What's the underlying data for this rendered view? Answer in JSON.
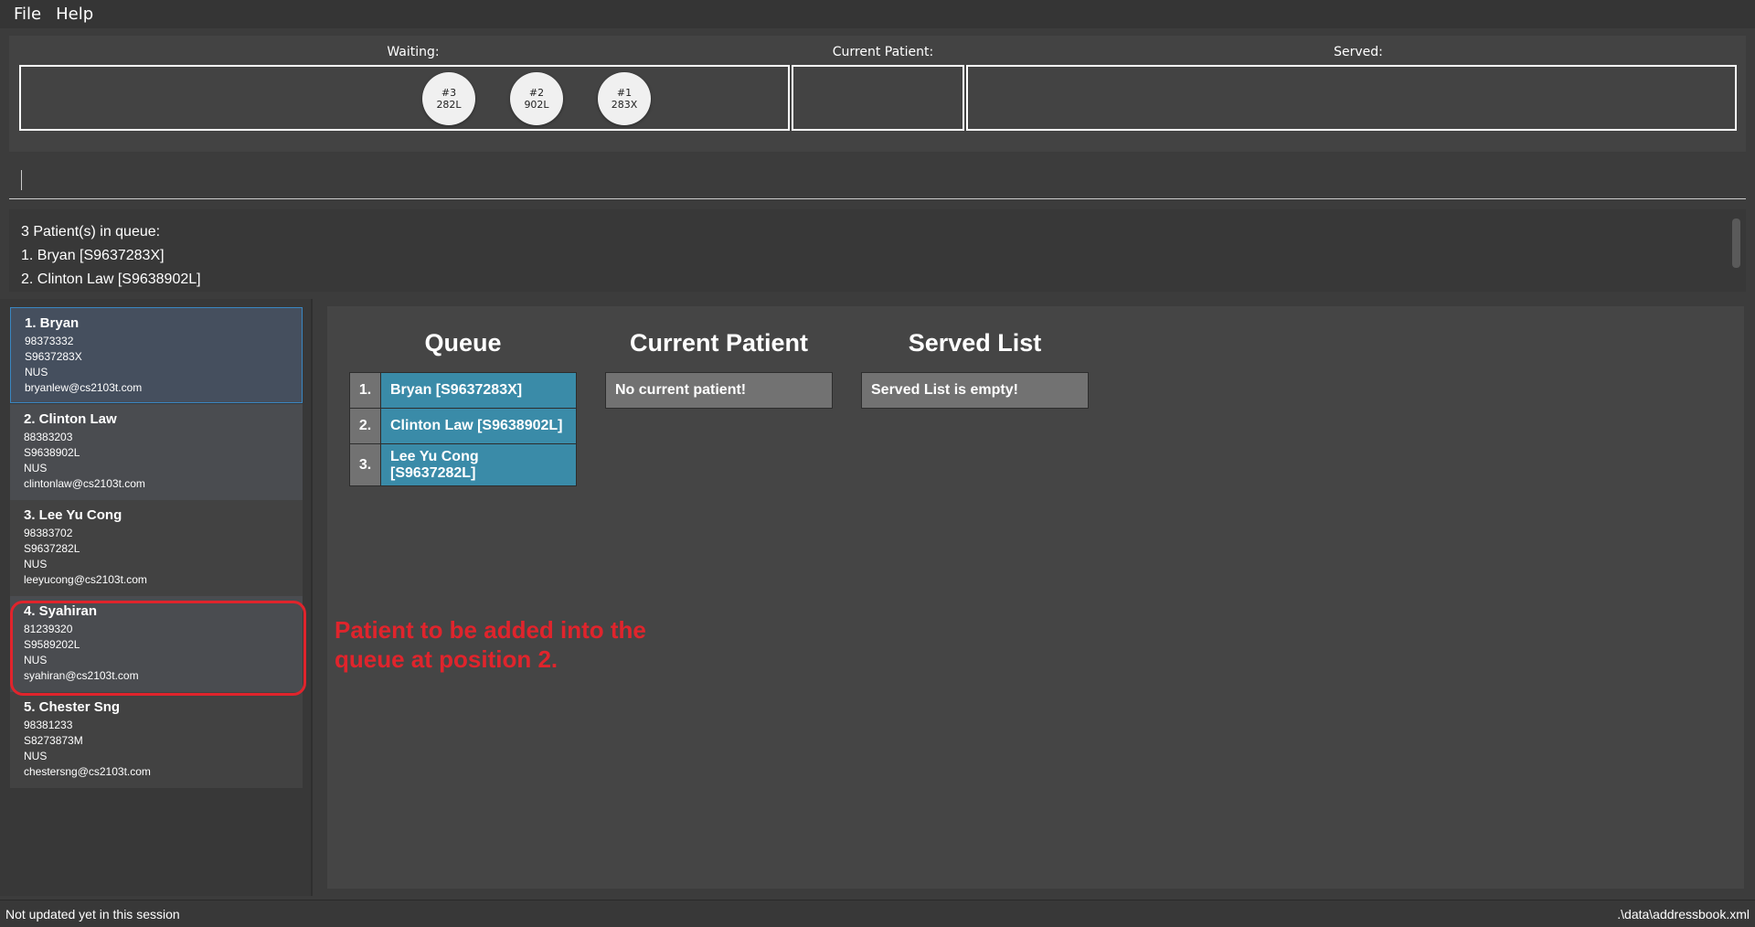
{
  "menu": {
    "file": "File",
    "help": "Help"
  },
  "queue_panel": {
    "waiting_label": "Waiting:",
    "current_label": "Current Patient:",
    "served_label": "Served:",
    "tokens": [
      {
        "num": "#3",
        "code": "282L"
      },
      {
        "num": "#2",
        "code": "902L"
      },
      {
        "num": "#1",
        "code": "283X"
      }
    ]
  },
  "command": {
    "value": ""
  },
  "result": {
    "lines": [
      "3 Patient(s) in queue:",
      "1. Bryan [S9637283X]",
      "2. Clinton Law [S9638902L]"
    ]
  },
  "patients": [
    {
      "name": "1.  Bryan",
      "phone": "98373332",
      "nric": "S9637283X",
      "school": "NUS",
      "email": "bryanlew@cs2103t.com"
    },
    {
      "name": "2.  Clinton Law",
      "phone": "88383203",
      "nric": "S9638902L",
      "school": "NUS",
      "email": "clintonlaw@cs2103t.com"
    },
    {
      "name": "3.  Lee Yu Cong",
      "phone": "98383702",
      "nric": "S9637282L",
      "school": "NUS",
      "email": "leeyucong@cs2103t.com"
    },
    {
      "name": "4.  Syahiran",
      "phone": "81239320",
      "nric": "S9589202L",
      "school": "NUS",
      "email": "syahiran@cs2103t.com"
    },
    {
      "name": "5.  Chester Sng",
      "phone": "98381233",
      "nric": "S8273873M",
      "school": "NUS",
      "email": "chestersng@cs2103t.com"
    }
  ],
  "browser": {
    "queue_title": "Queue",
    "current_title": "Current Patient",
    "served_title": "Served List",
    "queue": [
      {
        "num": "1.",
        "name": "Bryan [S9637283X]"
      },
      {
        "num": "2.",
        "name": "Clinton Law [S9638902L]"
      },
      {
        "num": "3.",
        "name": "Lee Yu Cong [S9637282L]"
      }
    ],
    "current_msg": "No current patient!",
    "served_msg": "Served List is empty!"
  },
  "annotation": "Patient to be added into the queue at position 2.",
  "status": {
    "left": "Not updated yet in this session",
    "right": ".\\data\\addressbook.xml"
  },
  "colors": {
    "accent": "#3a8ba8",
    "highlight": "#e0242c",
    "selected_border": "#3a86c1"
  }
}
